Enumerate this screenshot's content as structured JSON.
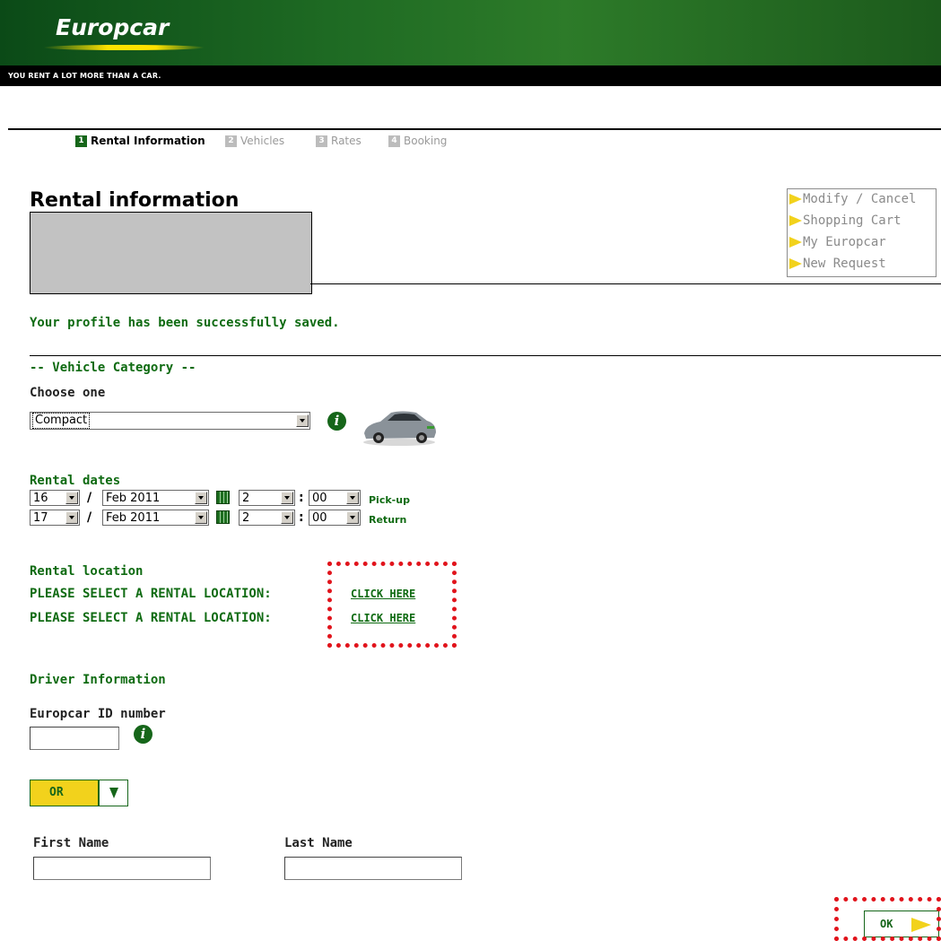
{
  "header": {
    "logo_text": "Europcar",
    "tagline": "YOU RENT A LOT MORE THAN A CAR."
  },
  "steps": [
    {
      "num": "1",
      "label": "Rental Information",
      "active": true
    },
    {
      "num": "2",
      "label": "Vehicles",
      "active": false
    },
    {
      "num": "3",
      "label": "Rates",
      "active": false
    },
    {
      "num": "4",
      "label": "Booking",
      "active": false
    }
  ],
  "page": {
    "title": "Rental information",
    "success_message": "Your profile has been successfully saved."
  },
  "side_menu": [
    {
      "label": "Modify / Cancel"
    },
    {
      "label": "Shopping Cart"
    },
    {
      "label": "My Europcar"
    },
    {
      "label": "New Request"
    }
  ],
  "vehicle": {
    "section_label": "-- Vehicle Category --",
    "choose_label": "Choose one",
    "selected": "Compact"
  },
  "dates": {
    "label": "Rental dates",
    "pickup": {
      "day": "16",
      "month": "Feb 2011",
      "hour": "2",
      "minute": "00",
      "label": "Pick-up"
    },
    "return": {
      "day": "17",
      "month": "Feb 2011",
      "hour": "2",
      "minute": "00",
      "label": "Return"
    },
    "slash": "/",
    "colon": ":"
  },
  "location": {
    "label": "Rental location",
    "pickup_prompt": "PLEASE SELECT A RENTAL LOCATION:",
    "return_prompt": "PLEASE SELECT A RENTAL LOCATION:",
    "pickup_link": "CLICK HERE",
    "return_link": "CLICK HERE"
  },
  "driver": {
    "label": "Driver Information",
    "id_label": "Europcar ID number",
    "or_label": "OR",
    "first_name_label": "First Name",
    "last_name_label": "Last Name"
  },
  "ok_label": "OK",
  "colors": {
    "brand_green": "#16661a",
    "text_green": "#0f6b12",
    "accent_yellow": "#f2d21c",
    "highlight_red": "#e1141c"
  }
}
